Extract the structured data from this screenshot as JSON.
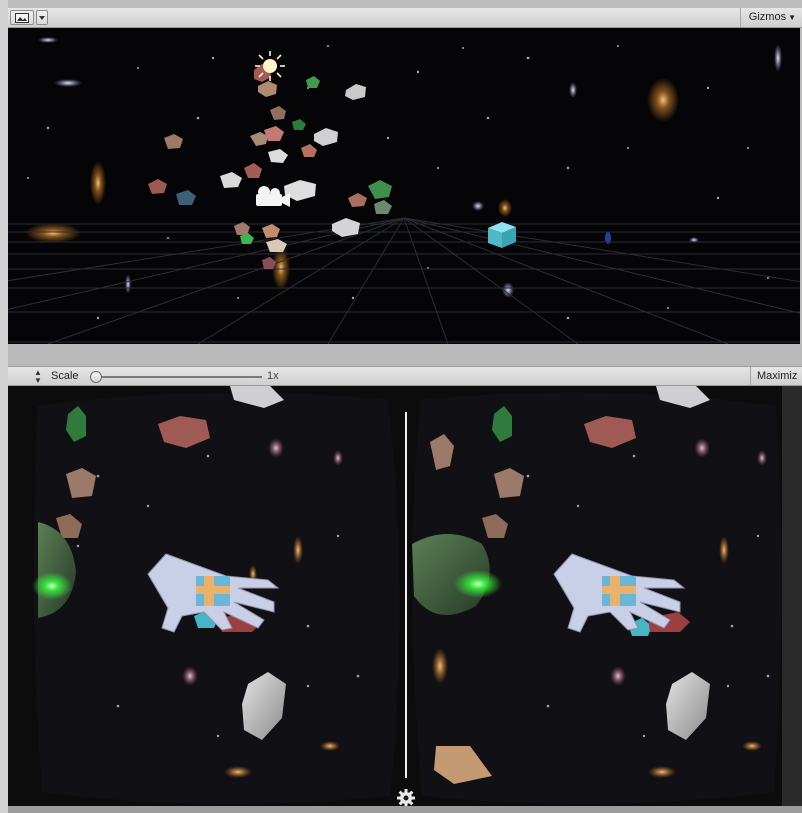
{
  "scene_toolbar": {
    "mode_icon": "image-icon",
    "gizmos_label": "Gizmos"
  },
  "game_toolbar": {
    "scale_label": "Scale",
    "scale_value": "1x",
    "scale_level": 0,
    "maximize_label": "Maximiz"
  },
  "game_view": {
    "settings_icon": "gear-icon"
  },
  "colors": {
    "toolbar": "#d8d8d8",
    "scene_bg": "#050507",
    "grid": "#2a2d33",
    "cube": "#5cc7d4",
    "hand": "#c9cfe6",
    "marker": "#e9b16a",
    "glow": "#35e63a"
  }
}
